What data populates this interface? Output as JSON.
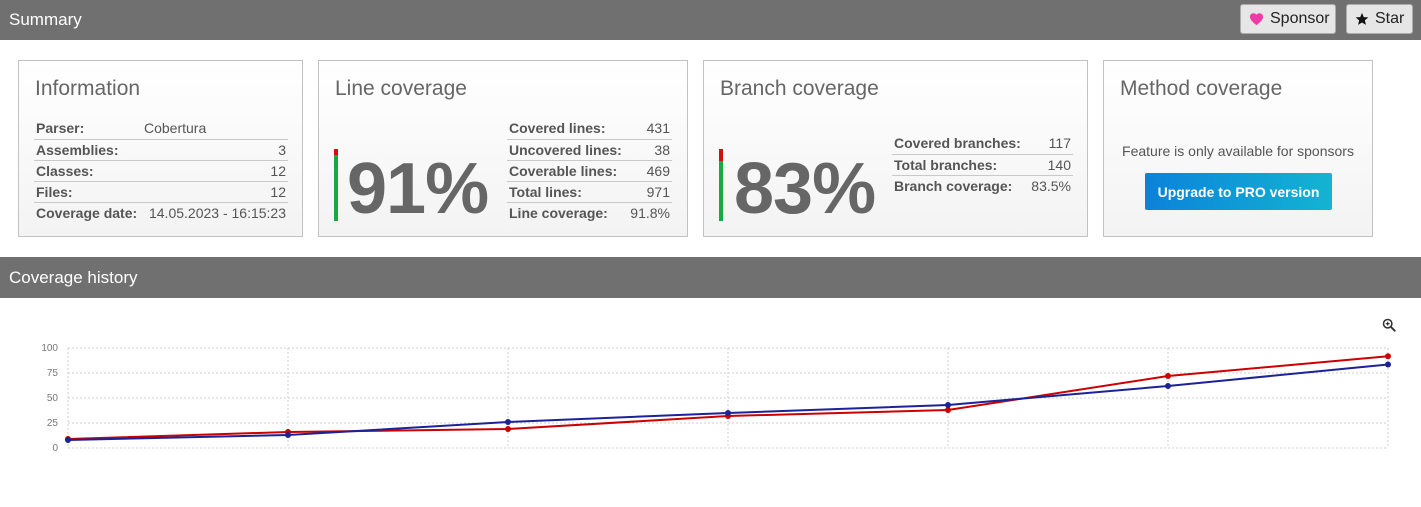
{
  "summary": {
    "title": "Summary",
    "sponsor_label": "Sponsor",
    "star_label": "Star"
  },
  "information": {
    "title": "Information",
    "rows": [
      {
        "label": "Parser:",
        "value": "Cobertura"
      },
      {
        "label": "Assemblies:",
        "value": "3"
      },
      {
        "label": "Classes:",
        "value": "12"
      },
      {
        "label": "Files:",
        "value": "12"
      },
      {
        "label": "Coverage date:",
        "value": "14.05.2023 - 16:15:23"
      }
    ]
  },
  "line_coverage": {
    "title": "Line coverage",
    "percent_text": "91%",
    "percent": 91.8,
    "rows": [
      {
        "label": "Covered lines:",
        "value": "431"
      },
      {
        "label": "Uncovered lines:",
        "value": "38"
      },
      {
        "label": "Coverable lines:",
        "value": "469"
      },
      {
        "label": "Total lines:",
        "value": "971"
      },
      {
        "label": "Line coverage:",
        "value": "91.8%"
      }
    ]
  },
  "branch_coverage": {
    "title": "Branch coverage",
    "percent_text": "83%",
    "percent": 83.5,
    "rows": [
      {
        "label": "Covered branches:",
        "value": "117"
      },
      {
        "label": "Total branches:",
        "value": "140"
      },
      {
        "label": "Branch coverage:",
        "value": "83.5%"
      }
    ]
  },
  "method_coverage": {
    "title": "Method coverage",
    "message": "Feature is only available for sponsors",
    "upgrade_label": "Upgrade to PRO version"
  },
  "history": {
    "title": "Coverage history"
  },
  "colors": {
    "header": "#707070",
    "line_series": "#cc0000",
    "branch_series": "#1c2298",
    "covered": "#1aa843",
    "uncovered": "#cf1010",
    "sponsor_heart": "#ee3ba6"
  },
  "chart_data": {
    "type": "line",
    "x": [
      1,
      2,
      3,
      4,
      5,
      6,
      7
    ],
    "ylim": [
      0,
      100
    ],
    "yticks": [
      "100",
      "75",
      "50",
      "25",
      "0"
    ],
    "grid": true,
    "series": [
      {
        "color": "#cc0000",
        "values": [
          9,
          16,
          19,
          32,
          38,
          72,
          91.8
        ]
      },
      {
        "color": "#1c2298",
        "values": [
          8,
          13,
          26,
          35,
          43,
          62,
          83.5
        ]
      }
    ]
  }
}
